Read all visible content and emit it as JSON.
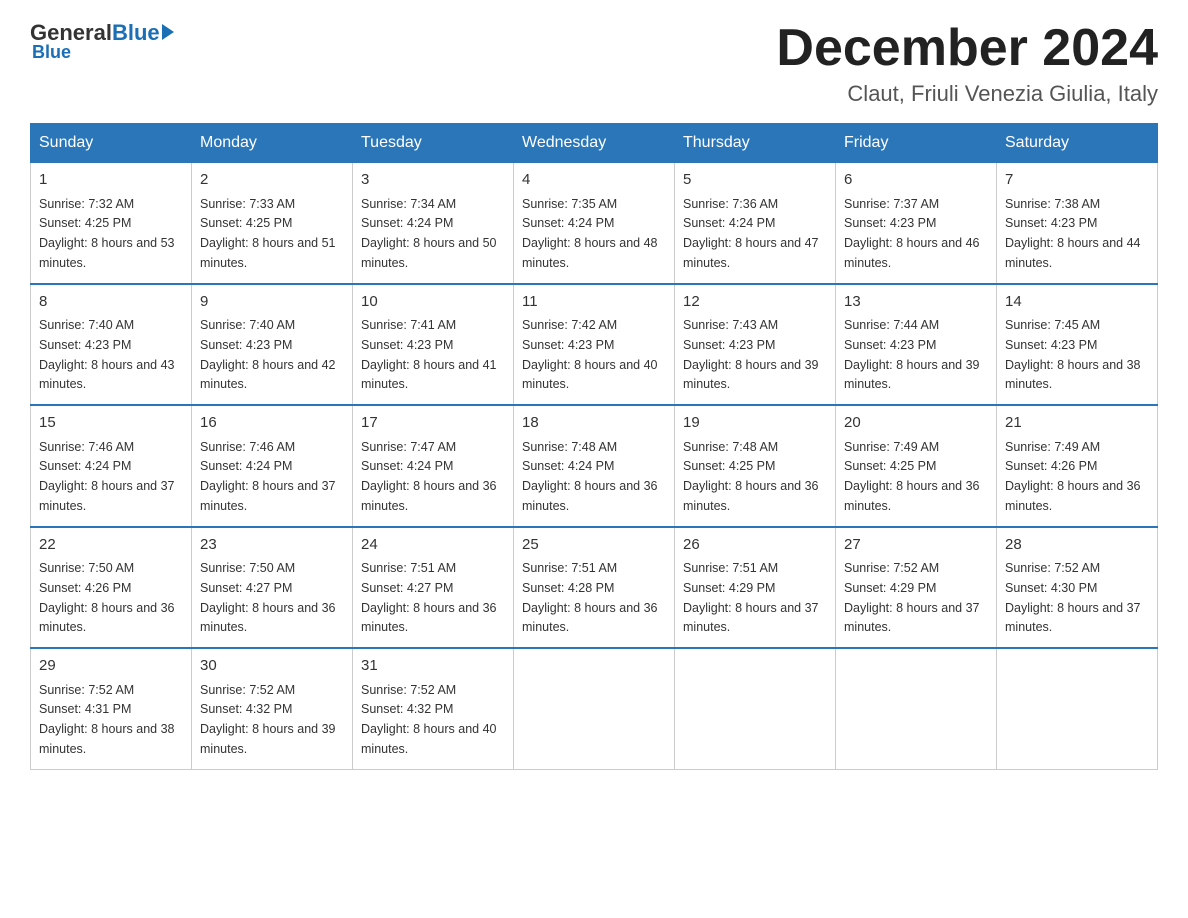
{
  "logo": {
    "general": "General",
    "blue": "Blue",
    "underline": "Blue"
  },
  "header": {
    "month_year": "December 2024",
    "location": "Claut, Friuli Venezia Giulia, Italy"
  },
  "days_of_week": [
    "Sunday",
    "Monday",
    "Tuesday",
    "Wednesday",
    "Thursday",
    "Friday",
    "Saturday"
  ],
  "weeks": [
    [
      {
        "date": "1",
        "sunrise": "Sunrise: 7:32 AM",
        "sunset": "Sunset: 4:25 PM",
        "daylight": "Daylight: 8 hours and 53 minutes."
      },
      {
        "date": "2",
        "sunrise": "Sunrise: 7:33 AM",
        "sunset": "Sunset: 4:25 PM",
        "daylight": "Daylight: 8 hours and 51 minutes."
      },
      {
        "date": "3",
        "sunrise": "Sunrise: 7:34 AM",
        "sunset": "Sunset: 4:24 PM",
        "daylight": "Daylight: 8 hours and 50 minutes."
      },
      {
        "date": "4",
        "sunrise": "Sunrise: 7:35 AM",
        "sunset": "Sunset: 4:24 PM",
        "daylight": "Daylight: 8 hours and 48 minutes."
      },
      {
        "date": "5",
        "sunrise": "Sunrise: 7:36 AM",
        "sunset": "Sunset: 4:24 PM",
        "daylight": "Daylight: 8 hours and 47 minutes."
      },
      {
        "date": "6",
        "sunrise": "Sunrise: 7:37 AM",
        "sunset": "Sunset: 4:23 PM",
        "daylight": "Daylight: 8 hours and 46 minutes."
      },
      {
        "date": "7",
        "sunrise": "Sunrise: 7:38 AM",
        "sunset": "Sunset: 4:23 PM",
        "daylight": "Daylight: 8 hours and 44 minutes."
      }
    ],
    [
      {
        "date": "8",
        "sunrise": "Sunrise: 7:40 AM",
        "sunset": "Sunset: 4:23 PM",
        "daylight": "Daylight: 8 hours and 43 minutes."
      },
      {
        "date": "9",
        "sunrise": "Sunrise: 7:40 AM",
        "sunset": "Sunset: 4:23 PM",
        "daylight": "Daylight: 8 hours and 42 minutes."
      },
      {
        "date": "10",
        "sunrise": "Sunrise: 7:41 AM",
        "sunset": "Sunset: 4:23 PM",
        "daylight": "Daylight: 8 hours and 41 minutes."
      },
      {
        "date": "11",
        "sunrise": "Sunrise: 7:42 AM",
        "sunset": "Sunset: 4:23 PM",
        "daylight": "Daylight: 8 hours and 40 minutes."
      },
      {
        "date": "12",
        "sunrise": "Sunrise: 7:43 AM",
        "sunset": "Sunset: 4:23 PM",
        "daylight": "Daylight: 8 hours and 39 minutes."
      },
      {
        "date": "13",
        "sunrise": "Sunrise: 7:44 AM",
        "sunset": "Sunset: 4:23 PM",
        "daylight": "Daylight: 8 hours and 39 minutes."
      },
      {
        "date": "14",
        "sunrise": "Sunrise: 7:45 AM",
        "sunset": "Sunset: 4:23 PM",
        "daylight": "Daylight: 8 hours and 38 minutes."
      }
    ],
    [
      {
        "date": "15",
        "sunrise": "Sunrise: 7:46 AM",
        "sunset": "Sunset: 4:24 PM",
        "daylight": "Daylight: 8 hours and 37 minutes."
      },
      {
        "date": "16",
        "sunrise": "Sunrise: 7:46 AM",
        "sunset": "Sunset: 4:24 PM",
        "daylight": "Daylight: 8 hours and 37 minutes."
      },
      {
        "date": "17",
        "sunrise": "Sunrise: 7:47 AM",
        "sunset": "Sunset: 4:24 PM",
        "daylight": "Daylight: 8 hours and 36 minutes."
      },
      {
        "date": "18",
        "sunrise": "Sunrise: 7:48 AM",
        "sunset": "Sunset: 4:24 PM",
        "daylight": "Daylight: 8 hours and 36 minutes."
      },
      {
        "date": "19",
        "sunrise": "Sunrise: 7:48 AM",
        "sunset": "Sunset: 4:25 PM",
        "daylight": "Daylight: 8 hours and 36 minutes."
      },
      {
        "date": "20",
        "sunrise": "Sunrise: 7:49 AM",
        "sunset": "Sunset: 4:25 PM",
        "daylight": "Daylight: 8 hours and 36 minutes."
      },
      {
        "date": "21",
        "sunrise": "Sunrise: 7:49 AM",
        "sunset": "Sunset: 4:26 PM",
        "daylight": "Daylight: 8 hours and 36 minutes."
      }
    ],
    [
      {
        "date": "22",
        "sunrise": "Sunrise: 7:50 AM",
        "sunset": "Sunset: 4:26 PM",
        "daylight": "Daylight: 8 hours and 36 minutes."
      },
      {
        "date": "23",
        "sunrise": "Sunrise: 7:50 AM",
        "sunset": "Sunset: 4:27 PM",
        "daylight": "Daylight: 8 hours and 36 minutes."
      },
      {
        "date": "24",
        "sunrise": "Sunrise: 7:51 AM",
        "sunset": "Sunset: 4:27 PM",
        "daylight": "Daylight: 8 hours and 36 minutes."
      },
      {
        "date": "25",
        "sunrise": "Sunrise: 7:51 AM",
        "sunset": "Sunset: 4:28 PM",
        "daylight": "Daylight: 8 hours and 36 minutes."
      },
      {
        "date": "26",
        "sunrise": "Sunrise: 7:51 AM",
        "sunset": "Sunset: 4:29 PM",
        "daylight": "Daylight: 8 hours and 37 minutes."
      },
      {
        "date": "27",
        "sunrise": "Sunrise: 7:52 AM",
        "sunset": "Sunset: 4:29 PM",
        "daylight": "Daylight: 8 hours and 37 minutes."
      },
      {
        "date": "28",
        "sunrise": "Sunrise: 7:52 AM",
        "sunset": "Sunset: 4:30 PM",
        "daylight": "Daylight: 8 hours and 37 minutes."
      }
    ],
    [
      {
        "date": "29",
        "sunrise": "Sunrise: 7:52 AM",
        "sunset": "Sunset: 4:31 PM",
        "daylight": "Daylight: 8 hours and 38 minutes."
      },
      {
        "date": "30",
        "sunrise": "Sunrise: 7:52 AM",
        "sunset": "Sunset: 4:32 PM",
        "daylight": "Daylight: 8 hours and 39 minutes."
      },
      {
        "date": "31",
        "sunrise": "Sunrise: 7:52 AM",
        "sunset": "Sunset: 4:32 PM",
        "daylight": "Daylight: 8 hours and 40 minutes."
      },
      {
        "date": "",
        "sunrise": "",
        "sunset": "",
        "daylight": ""
      },
      {
        "date": "",
        "sunrise": "",
        "sunset": "",
        "daylight": ""
      },
      {
        "date": "",
        "sunrise": "",
        "sunset": "",
        "daylight": ""
      },
      {
        "date": "",
        "sunrise": "",
        "sunset": "",
        "daylight": ""
      }
    ]
  ]
}
